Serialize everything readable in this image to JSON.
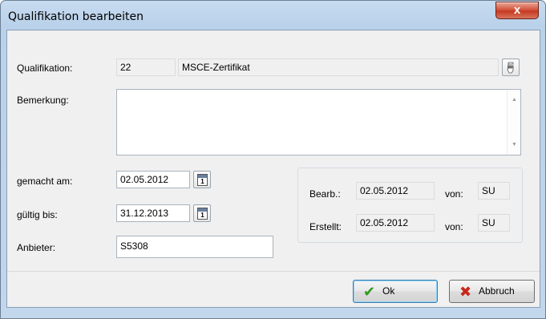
{
  "window": {
    "title": "Qualifikation bearbeiten",
    "close_glyph": "x"
  },
  "qualifikation": {
    "label": "Qualifikation:",
    "code": "22",
    "name": "MSCE-Zertifikat",
    "lookup_icon": "pointer-hand-icon"
  },
  "bemerkung": {
    "label": "Bemerkung:",
    "value": ""
  },
  "gemacht_am": {
    "label": "gemacht am:",
    "value": "02.05.2012"
  },
  "gueltig_bis": {
    "label": "gültig bis:",
    "value": "31.12.2013"
  },
  "anbieter": {
    "label": "Anbieter:",
    "value": "S5308"
  },
  "calendar_icon_text": "JAN\n1",
  "audit": {
    "bearb_label": "Bearb.:",
    "bearb_date": "02.05.2012",
    "bearb_von_label": "von:",
    "bearb_user": "SU",
    "erstellt_label": "Erstellt:",
    "erstellt_date": "02.05.2012",
    "erstellt_von_label": "von:",
    "erstellt_user": "SU"
  },
  "buttons": {
    "ok_label": "Ok",
    "cancel_label": "Abbruch"
  },
  "colors": {
    "ok_check": "#2e9b1f",
    "cancel_x": "#c8261a"
  }
}
